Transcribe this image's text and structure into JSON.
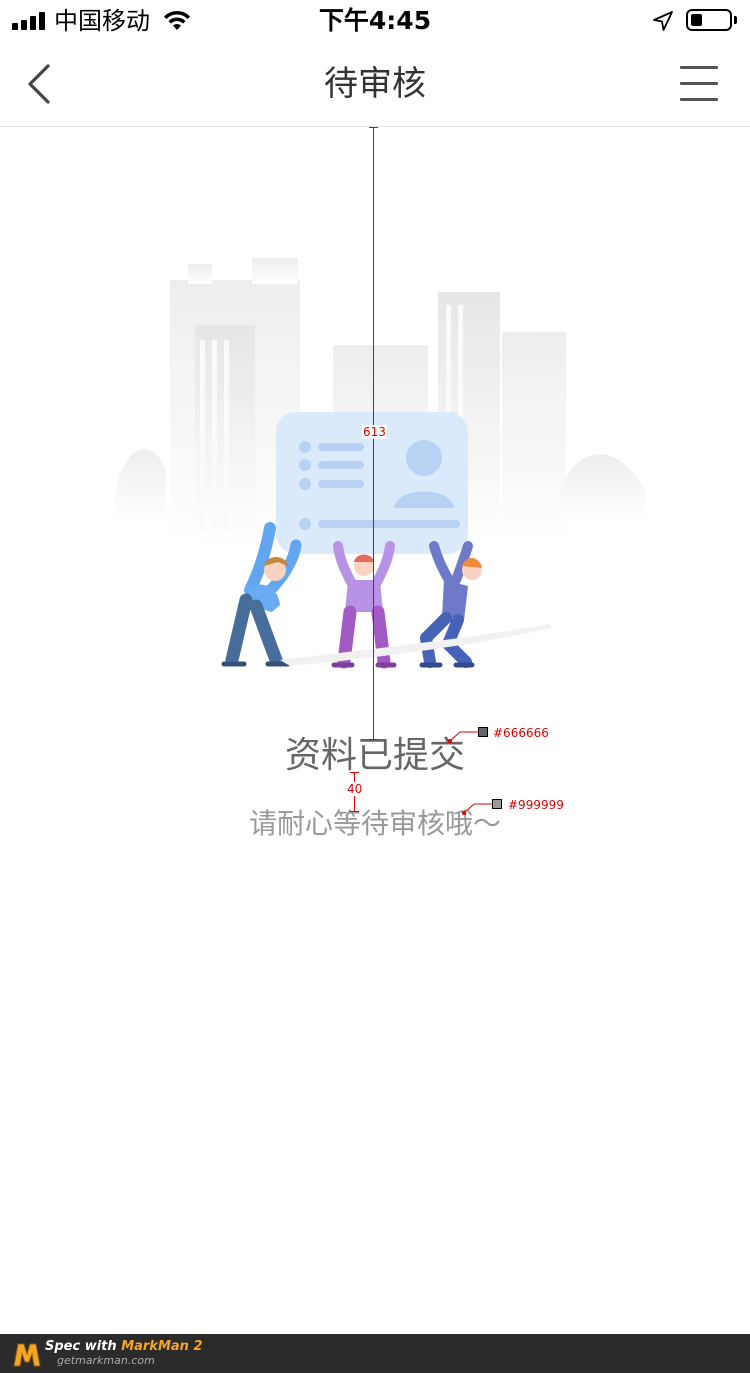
{
  "status_bar": {
    "carrier": "中国移动",
    "time": "下午4:45"
  },
  "nav": {
    "title": "待审核"
  },
  "main": {
    "title": "资料已提交",
    "subtitle": "请耐心等待审核哦～"
  },
  "annotations": {
    "distance_top": "613",
    "distance_gap": "40",
    "title_color": "#666666",
    "subtitle_color": "#999999"
  },
  "footer": {
    "spec_prefix": "Spec with ",
    "brand": "MarkMan 2",
    "site": "getmarkman.com"
  },
  "colors": {
    "title": "#666666",
    "subtitle": "#999999",
    "annotation": "#e00000",
    "card": "#dbeafb"
  }
}
